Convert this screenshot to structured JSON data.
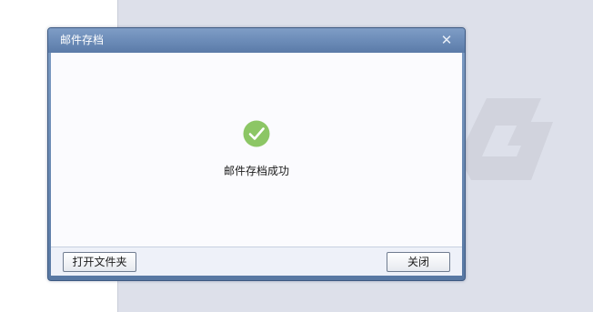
{
  "dialog": {
    "title": "邮件存档",
    "message": "邮件存档成功",
    "buttons": {
      "open_folder": "打开文件夹",
      "close": "关闭"
    }
  },
  "icons": {
    "close": "close-icon",
    "success": "success-check-icon",
    "watermark": "logo-watermark"
  },
  "colors": {
    "success_green": "#8cc665",
    "titlebar": "#6c8cb8",
    "background": "#dde0ea"
  }
}
